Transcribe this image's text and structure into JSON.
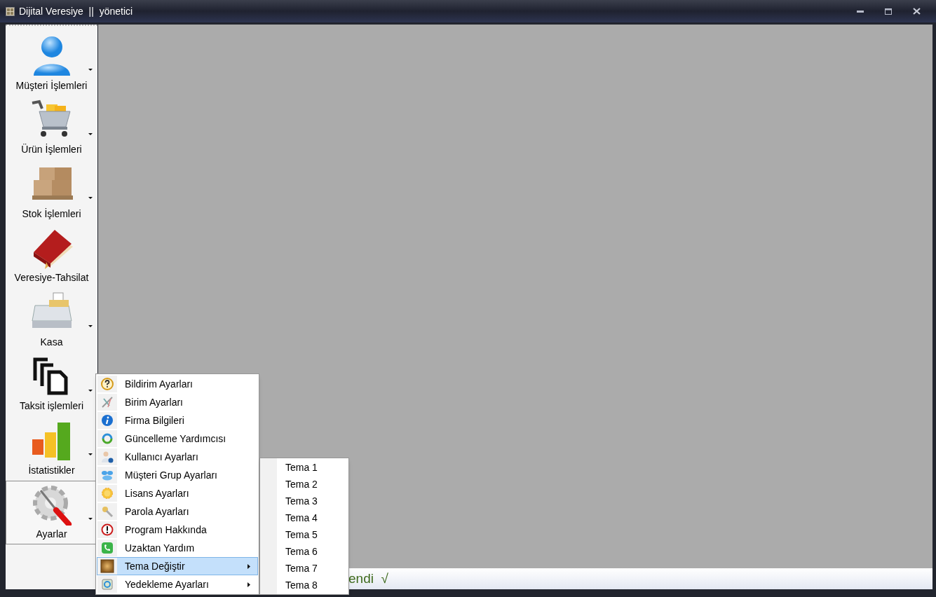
{
  "window": {
    "title": "Dijital Veresiye  ||  yönetici"
  },
  "sidebar": {
    "items": [
      {
        "label": "Müşteri İşlemleri",
        "dropdown": true,
        "selected": false
      },
      {
        "label": "Ürün İşlemleri",
        "dropdown": true,
        "selected": false
      },
      {
        "label": "Stok İşlemleri",
        "dropdown": true,
        "selected": false
      },
      {
        "label": "Veresiye-Tahsilat",
        "dropdown": false,
        "selected": false
      },
      {
        "label": "Kasa",
        "dropdown": true,
        "selected": false
      },
      {
        "label": "Taksit işlemleri",
        "dropdown": true,
        "selected": false
      },
      {
        "label": "İstatistikler",
        "dropdown": true,
        "selected": false
      },
      {
        "label": "Ayarlar",
        "dropdown": true,
        "selected": true
      }
    ]
  },
  "status_bar": {
    "text": "endi  √"
  },
  "context_menu": {
    "items": [
      {
        "label": "Bildirim Ayarları",
        "submenu": false,
        "selected": false
      },
      {
        "label": "Birim Ayarları",
        "submenu": false,
        "selected": false
      },
      {
        "label": "Firma Bilgileri",
        "submenu": false,
        "selected": false
      },
      {
        "label": "Güncelleme Yardımcısı",
        "submenu": false,
        "selected": false
      },
      {
        "label": "Kullanıcı Ayarları",
        "submenu": false,
        "selected": false
      },
      {
        "label": "Müşteri Grup Ayarları",
        "submenu": false,
        "selected": false
      },
      {
        "label": "Lisans Ayarları",
        "submenu": false,
        "selected": false
      },
      {
        "label": "Parola Ayarları",
        "submenu": false,
        "selected": false
      },
      {
        "label": "Program Hakkında",
        "submenu": false,
        "selected": false
      },
      {
        "label": "Uzaktan Yardım",
        "submenu": false,
        "selected": false
      },
      {
        "label": "Tema Değiştir",
        "submenu": true,
        "selected": true
      },
      {
        "label": "Yedekleme Ayarları",
        "submenu": true,
        "selected": false
      }
    ]
  },
  "submenu": {
    "items": [
      {
        "label": "Tema 1"
      },
      {
        "label": "Tema 2"
      },
      {
        "label": "Tema 3"
      },
      {
        "label": "Tema 4"
      },
      {
        "label": "Tema 5"
      },
      {
        "label": "Tema 6"
      },
      {
        "label": "Tema 7"
      },
      {
        "label": "Tema 8"
      }
    ]
  }
}
